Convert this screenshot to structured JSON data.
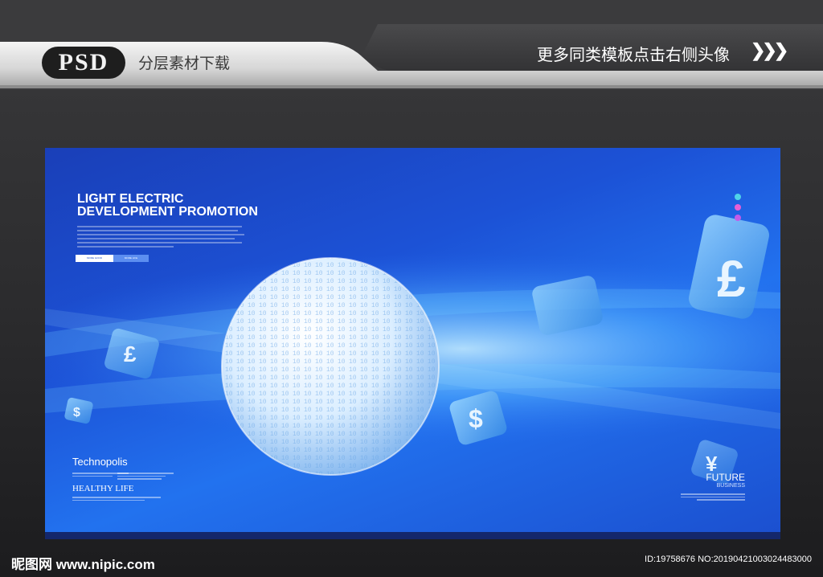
{
  "header": {
    "badge": "PSD",
    "caption": "分层素材下载",
    "promo": "更多同类模板点击右侧头像",
    "arrows": "❯❯❯"
  },
  "poster": {
    "headline_line1": "LIGHT ELECTRIC",
    "headline_line2": "DEVELOPMENT PROMOTION",
    "button1": "MORE GOOD",
    "button2": "MORE LIFE",
    "technopolis": "Technopolis",
    "healthy": "HEALTHY LIFE",
    "future": "FUTURE",
    "business": "BUSINESS",
    "currency_pound": "£",
    "currency_dollar": "$",
    "currency_yen": "¥",
    "sphere_binary": "1010011011001110100101001101010011",
    "accent_dots": [
      "#4fd3e8",
      "#e85fd6",
      "#c45be8"
    ]
  },
  "watermark": {
    "left": "昵图网 www.nipic.com",
    "right": "ID:19758676 NO:20190421003024483000"
  }
}
